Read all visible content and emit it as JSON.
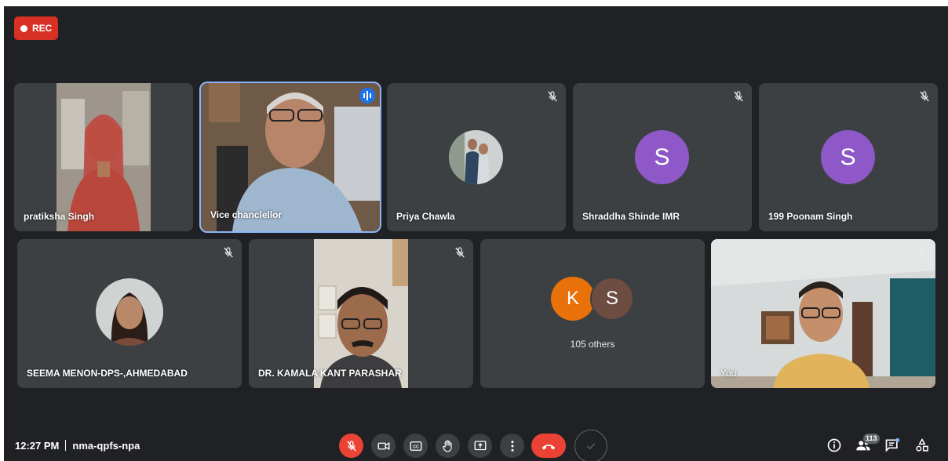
{
  "recording": {
    "label": "REC"
  },
  "tiles": [
    {
      "name": "pratiksha Singh"
    },
    {
      "name": "Vice chanclellor"
    },
    {
      "name": "Priya Chawla"
    },
    {
      "name": "Shraddha Shinde IMR",
      "initial": "S"
    },
    {
      "name": "199 Poonam Singh",
      "initial": "S"
    },
    {
      "name": "SEEMA MENON-DPS-,AHMEDABAD"
    },
    {
      "name": "DR. KAMALA KANT PARASHAR"
    },
    {
      "others_label": "105 others",
      "initials": [
        "K",
        "S"
      ]
    },
    {
      "name": "You"
    }
  ],
  "bottom_bar": {
    "time": "12:27 PM",
    "meeting_code": "nma-qpfs-npa",
    "participant_count": "113"
  },
  "colors": {
    "background": "#202124",
    "tile": "#3c4043",
    "accent_red": "#ea4335",
    "avatar_purple": "#8e58c9",
    "avatar_orange": "#e8710a",
    "avatar_brown": "#6d4c41",
    "speaking_outline": "#8ab4f8"
  },
  "icons": [
    "mic-off-icon",
    "camera-icon",
    "captions-icon",
    "hand-icon",
    "present-icon",
    "more-icon",
    "call-end-icon",
    "check-icon",
    "info-icon",
    "people-icon",
    "chat-icon",
    "activities-icon"
  ]
}
